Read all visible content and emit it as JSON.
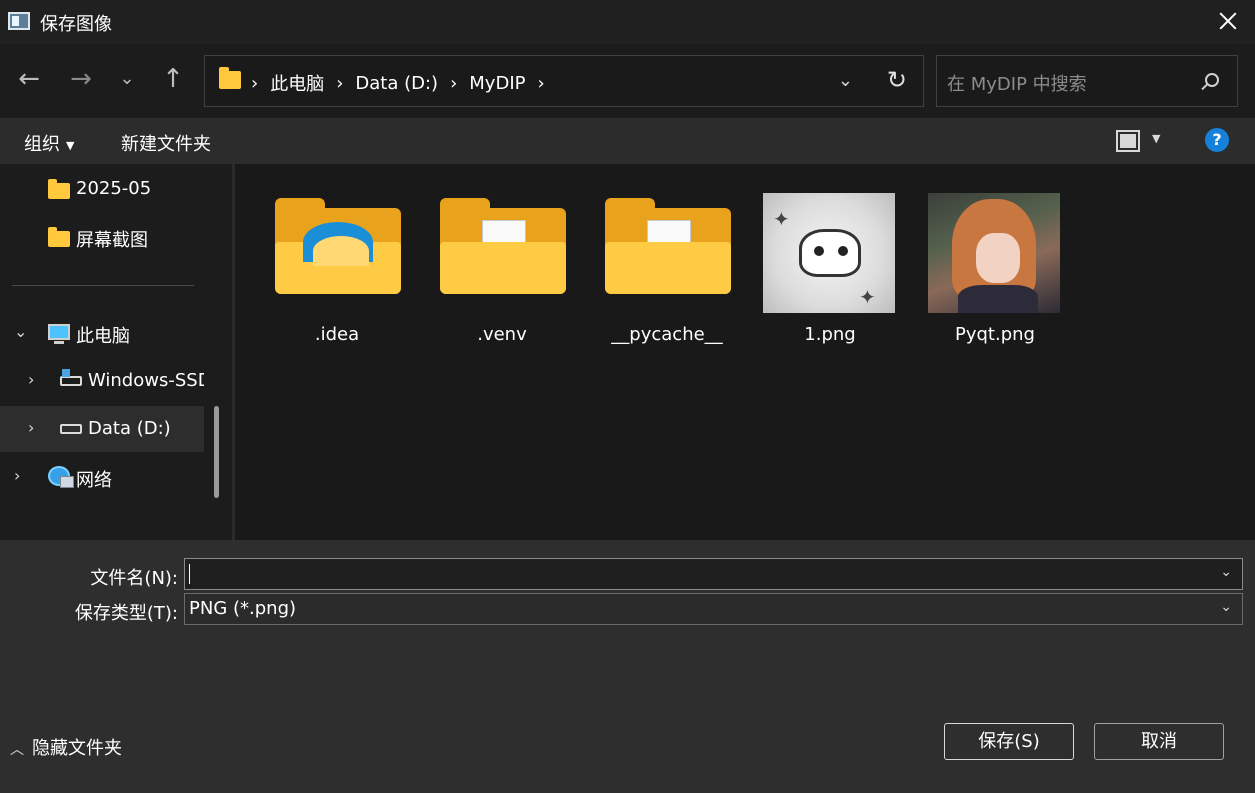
{
  "window": {
    "title": "保存图像"
  },
  "nav": {
    "back_icon": "←",
    "forward_icon": "→",
    "recent_icon": "⌄",
    "up_icon": "↑",
    "breadcrumbs": [
      "此电脑",
      "Data (D:)",
      "MyDIP"
    ],
    "separator": "›",
    "dropdown_icon": "⌄",
    "refresh_icon": "↻",
    "search_placeholder": "在 MyDIP 中搜索"
  },
  "commandbar": {
    "organize": "组织",
    "new_folder": "新建文件夹",
    "help": "?"
  },
  "sidebar": {
    "items": [
      {
        "label": "2025-05",
        "icon": "folder-icon"
      },
      {
        "label": "屏幕截图",
        "icon": "folder-icon"
      },
      {
        "label": "此电脑",
        "icon": "pc-icon",
        "chevron": "⌄"
      },
      {
        "label": "Windows-SSD",
        "icon": "drive-icon",
        "chevron": "›"
      },
      {
        "label": "Data (D:)",
        "icon": "drive-icon",
        "chevron": "›",
        "selected": true
      },
      {
        "label": "网络",
        "icon": "network-icon",
        "chevron": "›"
      }
    ]
  },
  "files": [
    {
      "name": ".idea",
      "type": "folder-logo"
    },
    {
      "name": ".venv",
      "type": "folder-doc"
    },
    {
      "name": "__pycache__",
      "type": "folder-doc"
    },
    {
      "name": "1.png",
      "type": "image"
    },
    {
      "name": "Pyqt.png",
      "type": "image"
    }
  ],
  "bottom": {
    "filename_label": "文件名(N):",
    "filename_value": "",
    "filetype_label": "保存类型(T):",
    "filetype_value": "PNG (*.png)",
    "hide_folders": "隐藏文件夹",
    "save_button": "保存(S)",
    "cancel_button": "取消"
  },
  "colors": {
    "folder": "#ffc83d",
    "accent": "#1581d8",
    "background": "#191919"
  }
}
